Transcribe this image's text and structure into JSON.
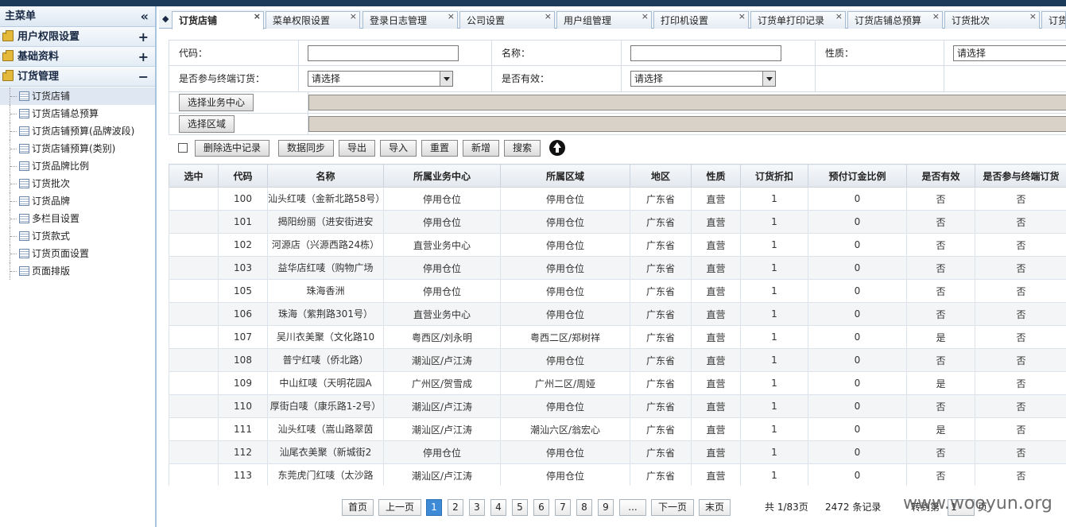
{
  "sidebar": {
    "title": "主菜单",
    "collapse_glyph": "«",
    "groups": [
      {
        "label": "用户权限设置",
        "toggle": "+"
      },
      {
        "label": "基础资料",
        "toggle": "+"
      },
      {
        "label": "订货管理",
        "toggle": "−"
      }
    ],
    "items": [
      {
        "label": "订货店铺"
      },
      {
        "label": "订货店铺总预算"
      },
      {
        "label": "订货店铺预算(品牌波段)"
      },
      {
        "label": "订货店铺预算(类别)"
      },
      {
        "label": "订货品牌比例"
      },
      {
        "label": "订货批次"
      },
      {
        "label": "订货品牌"
      },
      {
        "label": "多栏目设置"
      },
      {
        "label": "订货款式"
      },
      {
        "label": "订货页面设置"
      },
      {
        "label": "页面排版"
      }
    ]
  },
  "tabs": [
    {
      "label": "订货店铺"
    },
    {
      "label": "菜单权限设置"
    },
    {
      "label": "登录日志管理"
    },
    {
      "label": "公司设置"
    },
    {
      "label": "用户组管理"
    },
    {
      "label": "打印机设置"
    },
    {
      "label": "订货单打印记录"
    },
    {
      "label": "订货店铺总预算"
    },
    {
      "label": "订货批次"
    },
    {
      "label": "订货"
    }
  ],
  "filters": {
    "code_label": "代码：",
    "code_value": "",
    "name_label": "名称：",
    "name_value": "",
    "nature_label": "性质：",
    "nature_value": "请选择",
    "terminal_label": "是否参与终端订货：",
    "terminal_value": "请选择",
    "valid_label": "是否有效：",
    "valid_value": "请选择",
    "pick_center_label": "选择业务中心",
    "pick_region_label": "选择区域"
  },
  "toolbar": {
    "delete_label": "删除选中记录",
    "sync_label": "数据同步",
    "export_label": "导出",
    "import_label": "导入",
    "reset_label": "重置",
    "add_label": "新增",
    "search_label": "搜索",
    "up_icon": "arrow-up-circle-icon"
  },
  "table": {
    "headers": [
      "选中",
      "代码",
      "名称",
      "所属业务中心",
      "所属区域",
      "地区",
      "性质",
      "订货折扣",
      "预付订金比例",
      "是否有效",
      "是否参与终端订货"
    ],
    "rows": [
      {
        "code": "100",
        "name": "汕头红唛（金新北路58号）",
        "center": "停用仓位",
        "area": "停用仓位",
        "region": "广东省",
        "nature": "直营",
        "discount": "1",
        "deposit": "0",
        "valid": "否",
        "terminal": "否"
      },
      {
        "code": "101",
        "name": "揭阳纷丽（进安街进安",
        "center": "停用仓位",
        "area": "停用仓位",
        "region": "广东省",
        "nature": "直营",
        "discount": "1",
        "deposit": "0",
        "valid": "否",
        "terminal": "否"
      },
      {
        "code": "102",
        "name": "河源店（兴源西路24栋）",
        "center": "直营业务中心",
        "area": "停用仓位",
        "region": "广东省",
        "nature": "直营",
        "discount": "1",
        "deposit": "0",
        "valid": "否",
        "terminal": "否"
      },
      {
        "code": "103",
        "name": "益华店红唛（购物广场",
        "center": "停用仓位",
        "area": "停用仓位",
        "region": "广东省",
        "nature": "直营",
        "discount": "1",
        "deposit": "0",
        "valid": "否",
        "terminal": "否"
      },
      {
        "code": "105",
        "name": "珠海香洲",
        "center": "停用仓位",
        "area": "停用仓位",
        "region": "广东省",
        "nature": "直营",
        "discount": "1",
        "deposit": "0",
        "valid": "否",
        "terminal": "否"
      },
      {
        "code": "106",
        "name": "珠海（紫荆路301号）",
        "center": "直营业务中心",
        "area": "停用仓位",
        "region": "广东省",
        "nature": "直营",
        "discount": "1",
        "deposit": "0",
        "valid": "否",
        "terminal": "否"
      },
      {
        "code": "107",
        "name": "吴川衣美聚（文化路10",
        "center": "粤西区/刘永明",
        "area": "粤西二区/郑树祥",
        "region": "广东省",
        "nature": "直营",
        "discount": "1",
        "deposit": "0",
        "valid": "是",
        "terminal": "否"
      },
      {
        "code": "108",
        "name": "普宁红唛（侨北路）",
        "center": "潮汕区/卢江涛",
        "area": "停用仓位",
        "region": "广东省",
        "nature": "直营",
        "discount": "1",
        "deposit": "0",
        "valid": "否",
        "terminal": "否"
      },
      {
        "code": "109",
        "name": "中山红唛（天明花园A",
        "center": "广州区/贺雪成",
        "area": "广州二区/周娅",
        "region": "广东省",
        "nature": "直营",
        "discount": "1",
        "deposit": "0",
        "valid": "是",
        "terminal": "否"
      },
      {
        "code": "110",
        "name": "厚街白唛（康乐路1-2号）",
        "center": "潮汕区/卢江涛",
        "area": "停用仓位",
        "region": "广东省",
        "nature": "直营",
        "discount": "1",
        "deposit": "0",
        "valid": "否",
        "terminal": "否"
      },
      {
        "code": "111",
        "name": "汕头红唛（嵩山路翠茵",
        "center": "潮汕区/卢江涛",
        "area": "潮汕六区/翁宏心",
        "region": "广东省",
        "nature": "直营",
        "discount": "1",
        "deposit": "0",
        "valid": "是",
        "terminal": "否"
      },
      {
        "code": "112",
        "name": "汕尾衣美聚（新城街2",
        "center": "停用仓位",
        "area": "停用仓位",
        "region": "广东省",
        "nature": "直营",
        "discount": "1",
        "deposit": "0",
        "valid": "否",
        "terminal": "否"
      },
      {
        "code": "113",
        "name": "东莞虎门红唛（太沙路",
        "center": "潮汕区/卢江涛",
        "area": "停用仓位",
        "region": "广东省",
        "nature": "直营",
        "discount": "1",
        "deposit": "0",
        "valid": "否",
        "terminal": "否"
      }
    ]
  },
  "pager": {
    "first_label": "首页",
    "prev_label": "上一页",
    "pages": [
      "1",
      "2",
      "3",
      "4",
      "5",
      "6",
      "7",
      "8",
      "9"
    ],
    "current_page": "1",
    "ellipsis": "...",
    "next_label": "下一页",
    "last_label": "末页",
    "page_info": "共 1/83页",
    "record_info": "2472 条记录",
    "jump_label": "转到第",
    "jump_value": "1",
    "jump_suffix": "页"
  },
  "watermark": "www.wooyun.org",
  "colors": {
    "topbar": "#1c3a5a",
    "active_page": "#3d8ad6",
    "readonly_field": "#d8d2c8"
  }
}
